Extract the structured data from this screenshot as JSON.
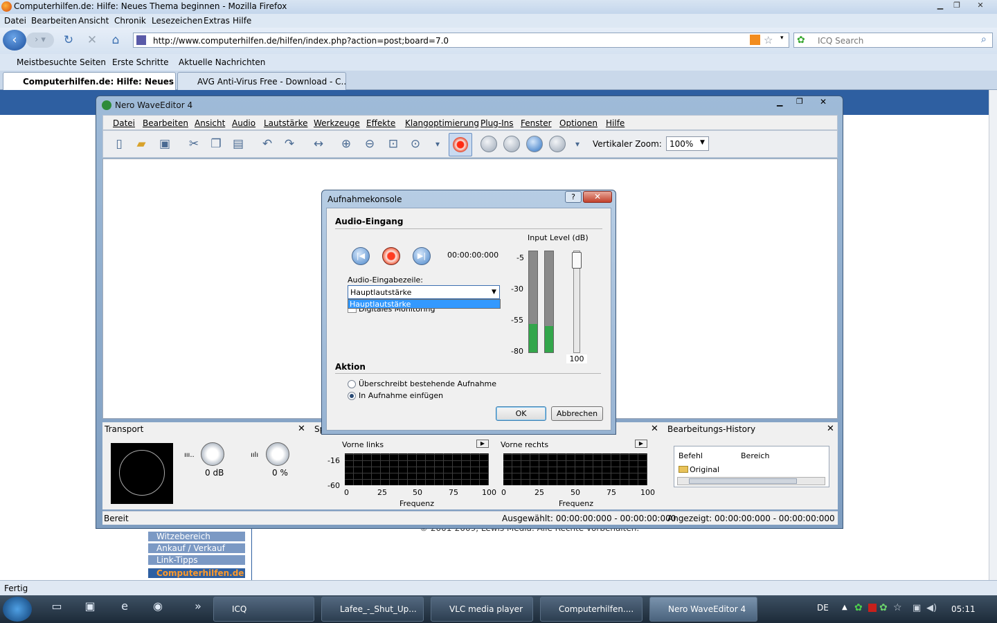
{
  "browser": {
    "title": "Computerhilfen.de: Hilfe: Neues Thema beginnen - Mozilla Firefox",
    "menu": [
      "Datei",
      "Bearbeiten",
      "Ansicht",
      "Chronik",
      "Lesezeichen",
      "Extras",
      "Hilfe"
    ],
    "url": "http://www.computerhilfen.de/hilfen/index.php?action=post;board=7.0",
    "search_placeholder": "ICQ Search",
    "bookmarks": [
      "Meistbesuchte Seiten",
      "Erste Schritte",
      "Aktuelle Nachrichten"
    ],
    "tabs": [
      {
        "label": "Computerhilfen.de: Hilfe: Neues ...",
        "active": true
      },
      {
        "label": "AVG Anti-Virus Free - Download - C...",
        "active": false
      }
    ],
    "status": "Fertig"
  },
  "page": {
    "side_links": [
      "Witzebereich",
      "Ankauf / Verkauf",
      "Link-Tipps",
      "Computerhilfen.de"
    ],
    "footer": "© 2001-2009, Lewis Media. Alle Rechte vorbehalten."
  },
  "nero": {
    "title": "Nero WaveEditor 4",
    "menu": [
      "Datei",
      "Bearbeiten",
      "Ansicht",
      "Audio",
      "Lautstärke",
      "Werkzeuge",
      "Effekte",
      "Klangoptimierung",
      "Plug-Ins",
      "Fenster",
      "Optionen",
      "Hilfe"
    ],
    "zoom_label": "Vertikaler Zoom:",
    "zoom_value": "100%",
    "transport": {
      "title": "Transport",
      "knob1_value": "0 dB",
      "knob2_value": "0 %"
    },
    "spectrum": {
      "title_fragment": "Sp",
      "left_label": "Vorne links",
      "right_label": "Vorne rechts",
      "y_ticks": [
        "-16",
        "-60"
      ],
      "x_ticks": [
        "0",
        "25",
        "50",
        "75",
        "100"
      ],
      "x_axis_label": "Frequenz"
    },
    "history": {
      "title": "Bearbeitungs-History",
      "col_command": "Befehl",
      "col_range": "Bereich",
      "item": "Original"
    },
    "status": {
      "left": "Bereit",
      "selected": "Ausgewählt: 00:00:00:000 - 00:00:00:000",
      "shown": "Angezeigt: 00:00:00:000 - 00:00:00:000"
    }
  },
  "dialog": {
    "title": "Aufnahmekonsole",
    "help_label": "?",
    "close_label": "✕",
    "section_input": "Audio-Eingang",
    "timecode": "00:00:00:000",
    "input_level_label": "Input Level (dB)",
    "db_ticks": [
      "-5",
      "-30",
      "-55",
      "-80"
    ],
    "meter_levels": [
      0.28,
      0.26
    ],
    "volume_value": "100",
    "input_line_label": "Audio-Eingabezeile:",
    "input_line_value": "Hauptlautstärke",
    "input_line_option": "Hauptlautstärke",
    "monitoring_label": "Digitales Monitoring",
    "section_action": "Aktion",
    "radio_overwrite": "Überschreibt bestehende Aufnahme",
    "radio_insert": "In Aufnahme einfügen",
    "ok_label": "OK",
    "cancel_label": "Abbrechen"
  },
  "taskbar": {
    "items": [
      {
        "label": "ICQ",
        "active": false
      },
      {
        "label": "Lafee_-_Shut_Up...",
        "active": false
      },
      {
        "label": "VLC media player",
        "active": false
      },
      {
        "label": "Computerhilfen....",
        "active": false
      },
      {
        "label": "Nero WaveEditor 4",
        "active": true
      }
    ],
    "language": "DE",
    "time": "05:11"
  }
}
